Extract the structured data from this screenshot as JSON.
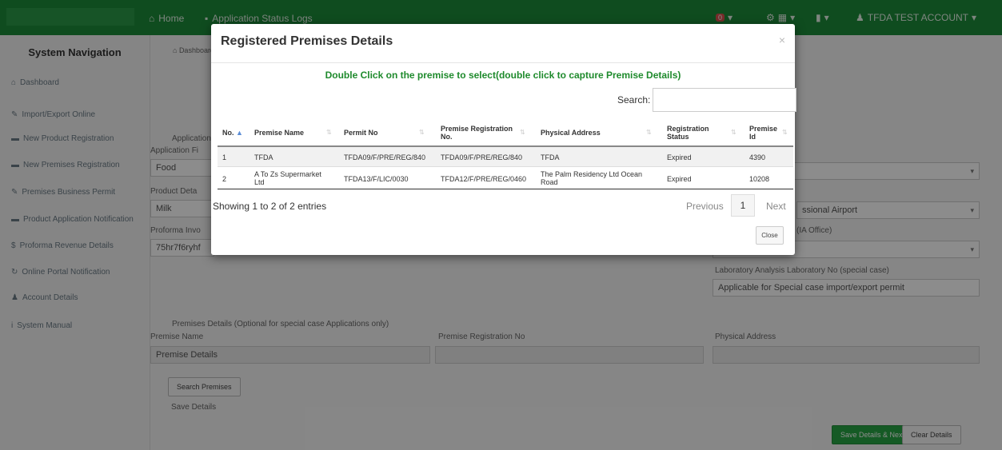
{
  "topbar": {
    "home": "Home",
    "app_status": "Application Status Logs",
    "notif_count": "0",
    "account": "TFDA TEST ACCOUNT"
  },
  "sidebar": {
    "title": "System Navigation",
    "items": [
      {
        "label": "Dashboard",
        "icon": "home-icon"
      },
      {
        "label": "Import/Export Online",
        "icon": "pencil-icon"
      },
      {
        "label": "New Product Registration",
        "icon": "truck-icon"
      },
      {
        "label": "New Premises Registration",
        "icon": "truck-icon"
      },
      {
        "label": "Premises Business Permit",
        "icon": "pencil-icon"
      },
      {
        "label": "Product Application Notification",
        "icon": "truck-icon"
      },
      {
        "label": "Proforma Revenue Details",
        "icon": "money-icon"
      },
      {
        "label": "Online Portal Notification",
        "icon": "refresh-icon"
      },
      {
        "label": "Account Details",
        "icon": "user-icon"
      },
      {
        "label": "System Manual",
        "icon": "info-icon"
      }
    ]
  },
  "main": {
    "breadcrumb": "Dashboard",
    "app_label": "Application",
    "app_type_label": "Application Fi",
    "app_type_value": "Food",
    "product_label": "Product Deta",
    "product_value": "Milk",
    "proforma_label": "Proforma Invo",
    "proforma_value": "75hr7f6ryhf",
    "port_value": "ssional Airport",
    "office_label": "(IA Office)",
    "lab_label": "Laboratory Analysis Laboratory No (special case)",
    "lab_value": "Applicable for Special case import/export permit",
    "premises_section": "Premises Details (Optional for special case Applications only)",
    "premise_name_label": "Premise Name",
    "premise_reg_label": "Premise Registration No",
    "physical_label": "Physical Address",
    "premise_name_value": "Premise Details",
    "search_btn": "Search Premises",
    "save_label": "Save Details",
    "save_next_btn": "Save Details & Next",
    "clear_btn": "Clear Details"
  },
  "modal": {
    "title": "Registered Premises Details",
    "close_x": "×",
    "instruction": "Double Click on the premise to select(double click to capture Premise Details)",
    "search_label": "Search:",
    "search_value": "",
    "columns": {
      "no": "No.",
      "name": "Premise Name",
      "permit": "Permit No",
      "reg_l1": "Premise Registration",
      "reg_l2": "No.",
      "address": "Physical Address",
      "status_l1": "Registration",
      "status_l2": "Status",
      "id_l1": "Premise",
      "id_l2": "Id"
    },
    "rows": [
      {
        "no": "1",
        "name": "TFDA",
        "permit": "TFDA09/F/PRE/REG/840",
        "reg": "TFDA09/F/PRE/REG/840",
        "address": "TFDA",
        "status": "Expired",
        "id": "4390"
      },
      {
        "no": "2",
        "name_l1": "A To Zs Supermarket",
        "name_l2": "Ltd",
        "permit": "TFDA13/F/LIC/0030",
        "reg": "TFDA12/F/PRE/REG/0460",
        "address_l1": "The Palm Residency Ltd Ocean",
        "address_l2": "Road",
        "status": "Expired",
        "id": "10208"
      }
    ],
    "showing": "Showing 1 to 2 of 2 entries",
    "prev": "Previous",
    "page": "1",
    "next": "Next",
    "close_btn": "Close"
  },
  "colors": {
    "navbar": "#1d8a3a",
    "instruction": "#1e8a2c",
    "save_next": "#27a544"
  }
}
